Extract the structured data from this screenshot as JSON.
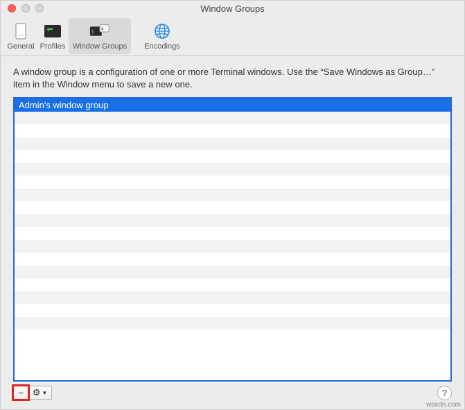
{
  "window": {
    "title": "Window Groups"
  },
  "toolbar": {
    "general_label": "General",
    "profiles_label": "Profiles",
    "window_groups_label": "Window Groups",
    "encodings_label": "Encodings"
  },
  "content": {
    "description": "A window group is a configuration of one or more Terminal windows. Use the “Save Windows as Group…” item in the Window menu to save a new one.",
    "list": {
      "items": [
        {
          "label": "Admin's window group",
          "selected": true
        }
      ],
      "blank_rows": 18
    }
  },
  "footer": {
    "remove_label": "−",
    "gear_label": "⚙",
    "help_label": "?"
  },
  "watermark": "wsxdn.com"
}
